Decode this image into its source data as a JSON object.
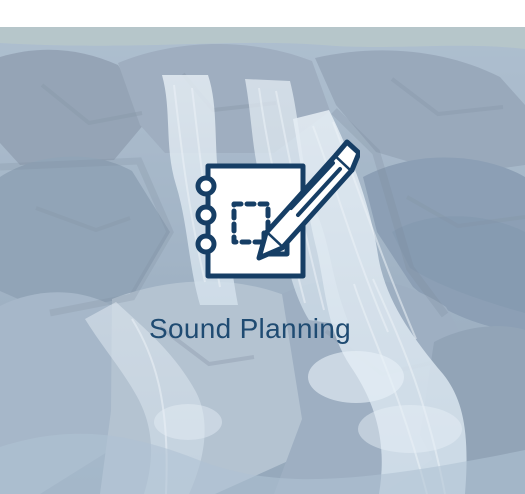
{
  "feature": {
    "title": "Sound Planning",
    "icon": "notebook-pen-icon"
  },
  "colors": {
    "text": "#1f4b72",
    "icon_stroke": "#163e65",
    "icon_fill": "#ffffff"
  }
}
